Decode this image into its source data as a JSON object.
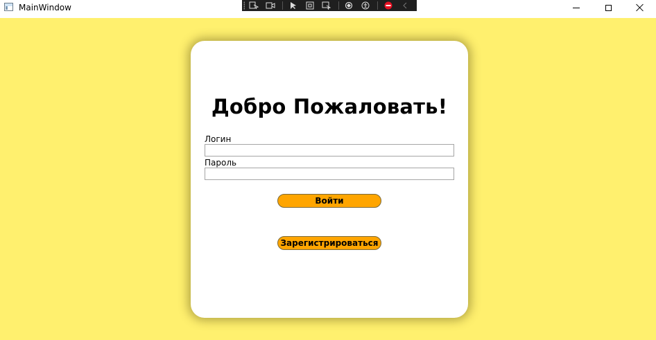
{
  "window": {
    "title": "MainWindow"
  },
  "titlebar_controls": [
    "minimize-icon",
    "maximize-icon",
    "close-icon"
  ],
  "debug_toolbar": {
    "icons": [
      "select-element-icon",
      "record-icon",
      "pointer-select-icon",
      "layout-adorner-icon",
      "track-focus-icon",
      "hot-reload-icon",
      "accessibility-icon",
      "disable-icon",
      "collapse-chevron-icon"
    ]
  },
  "colors": {
    "background": "#fff06e",
    "card": "#ffffff",
    "button": "#ffa500"
  },
  "login_card": {
    "title": "Добро Пожаловать!",
    "login_label": "Логин",
    "login_value": "",
    "password_label": "Пароль",
    "password_value": "",
    "login_button": "Войти",
    "register_button": "Зарегистрироваться"
  }
}
